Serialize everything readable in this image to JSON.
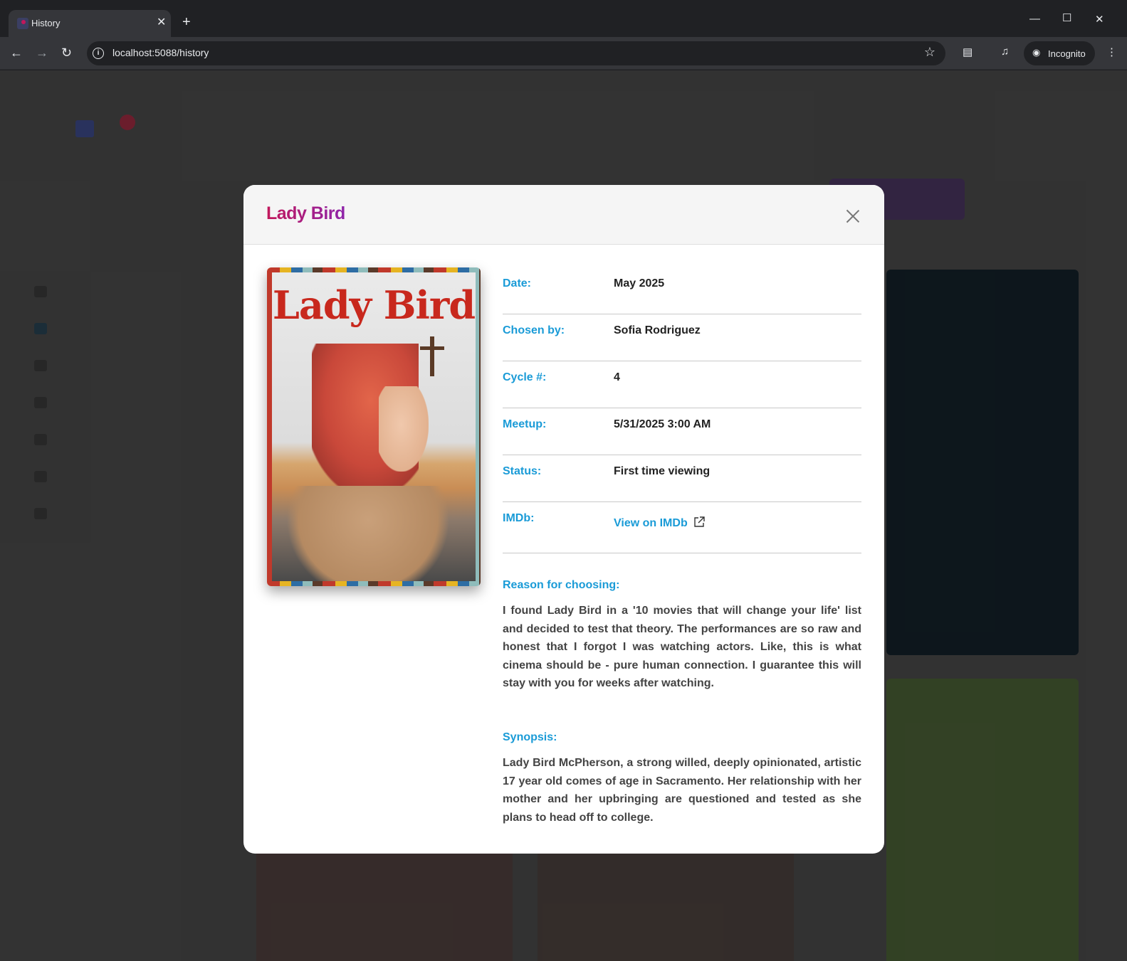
{
  "browser": {
    "tab_title": "History",
    "tab_close": "✕",
    "new_tab": "+",
    "url": "localhost:5088/history",
    "incognito_label": "Incognito",
    "icons": [
      "back-icon",
      "forward-icon",
      "reload-icon",
      "info-icon",
      "star-icon",
      "search-tabs-icon",
      "media-icon",
      "incognito-icon",
      "menu-icon",
      "minimize-icon",
      "maximize-icon",
      "close-window-icon"
    ]
  },
  "modal": {
    "title": "Lady Bird",
    "poster_title": "Lady Bird",
    "rows": [
      {
        "label": "Date:",
        "value": "May 2025"
      },
      {
        "label": "Chosen by:",
        "value": "Sofia Rodriguez"
      },
      {
        "label": "Cycle #:",
        "value": "4"
      },
      {
        "label": "Meetup:",
        "value": "5/31/2025 3:00 AM"
      },
      {
        "label": "Status:",
        "value": "First time viewing"
      }
    ],
    "imdb": {
      "label": "IMDb:",
      "link_text": "View on IMDb"
    },
    "reason": {
      "label": "Reason for choosing:",
      "text": "I found Lady Bird in a '10 movies that will change your life' list and decided to test that theory. The performances are so raw and honest that I forgot I was watching actors. Like, this is what cinema should be - pure human connection. I guarantee this will stay with you for weeks after watching."
    },
    "synopsis": {
      "label": "Synopsis:",
      "text": "Lady Bird McPherson, a strong willed, deeply opinionated, artistic 17 year old comes of age in Sacramento. Her relationship with her mother and her upbringing are questioned and tested as she plans to head off to college."
    }
  },
  "colors": {
    "accent_blue": "#1a9bd7",
    "title_gradient_start": "#c2185b",
    "title_gradient_end": "#8e24aa"
  }
}
